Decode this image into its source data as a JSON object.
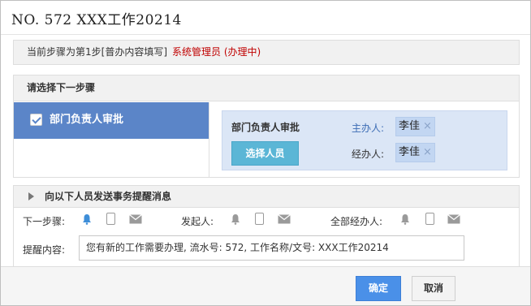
{
  "dialog": {
    "title": "NO. 572 XXX工作20214"
  },
  "current_step": {
    "text": "当前步骤为第1步[普办内容填写]",
    "handler": "系统管理员 (办理中)"
  },
  "next_step": {
    "header": "请选择下一步骤",
    "option_label": "部门负责人审批",
    "option_checked": true,
    "detail_title": "部门负责人审批",
    "select_button": "选择人员",
    "main_handler_label": "主办人:",
    "main_handler_value": "李佳",
    "assistant_label": "经办人:",
    "assistant_value": "李佳",
    "remove_symbol": "×"
  },
  "reminder": {
    "header": "向以下人员发送事务提醒消息",
    "next_step_label": "下一步骤:",
    "initiator_label": "发起人:",
    "all_handlers_label": "全部经办人:",
    "content_label": "提醒内容:",
    "content_value": "您有新的工作需要办理, 流水号: 572, 工作名称/文号: XXX工作20214"
  },
  "footer": {
    "ok_label": "确定",
    "cancel_label": "取消"
  },
  "colors": {
    "selected_step": "#5b85c8",
    "active_bell": "#3e8ed8",
    "inactive_icon": "#9a9a9a",
    "ok_button": "#4a90e8",
    "handler_text": "#c00000"
  }
}
